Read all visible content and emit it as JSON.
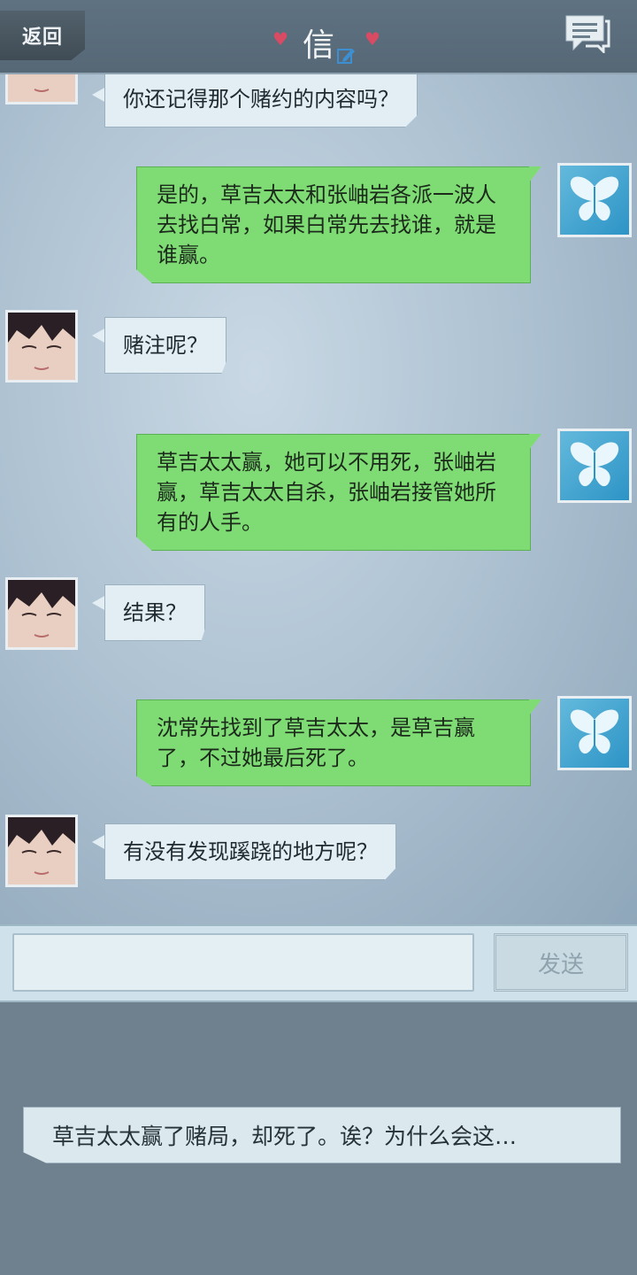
{
  "header": {
    "back_label": "返回",
    "title": "信"
  },
  "messages": [
    {
      "sender": "npc",
      "text": "你还记得那个赌约的内容吗？"
    },
    {
      "sender": "me",
      "text": "是的，草吉太太和张岫岩各派一波人去找白常，如果白常先去找谁，就是谁赢。"
    },
    {
      "sender": "npc",
      "text": "赌注呢？"
    },
    {
      "sender": "me",
      "text": "草吉太太赢，她可以不用死，张岫岩赢，草吉太太自杀，张岫岩接管她所有的人手。"
    },
    {
      "sender": "npc",
      "text": "结果？"
    },
    {
      "sender": "me",
      "text": "沈常先找到了草吉太太，是草吉赢了，不过她最后死了。"
    },
    {
      "sender": "npc",
      "text": "有没有发现蹊跷的地方呢？"
    }
  ],
  "input": {
    "value": "",
    "send_label": "发送"
  },
  "narration": {
    "text": "草吉太太赢了赌局，却死了。诶？为什么会这…"
  },
  "colors": {
    "npc_bubble": "#e2eef3",
    "my_bubble": "#7fdc74",
    "header": "#5f7282",
    "accent_heart": "#d94a63"
  }
}
